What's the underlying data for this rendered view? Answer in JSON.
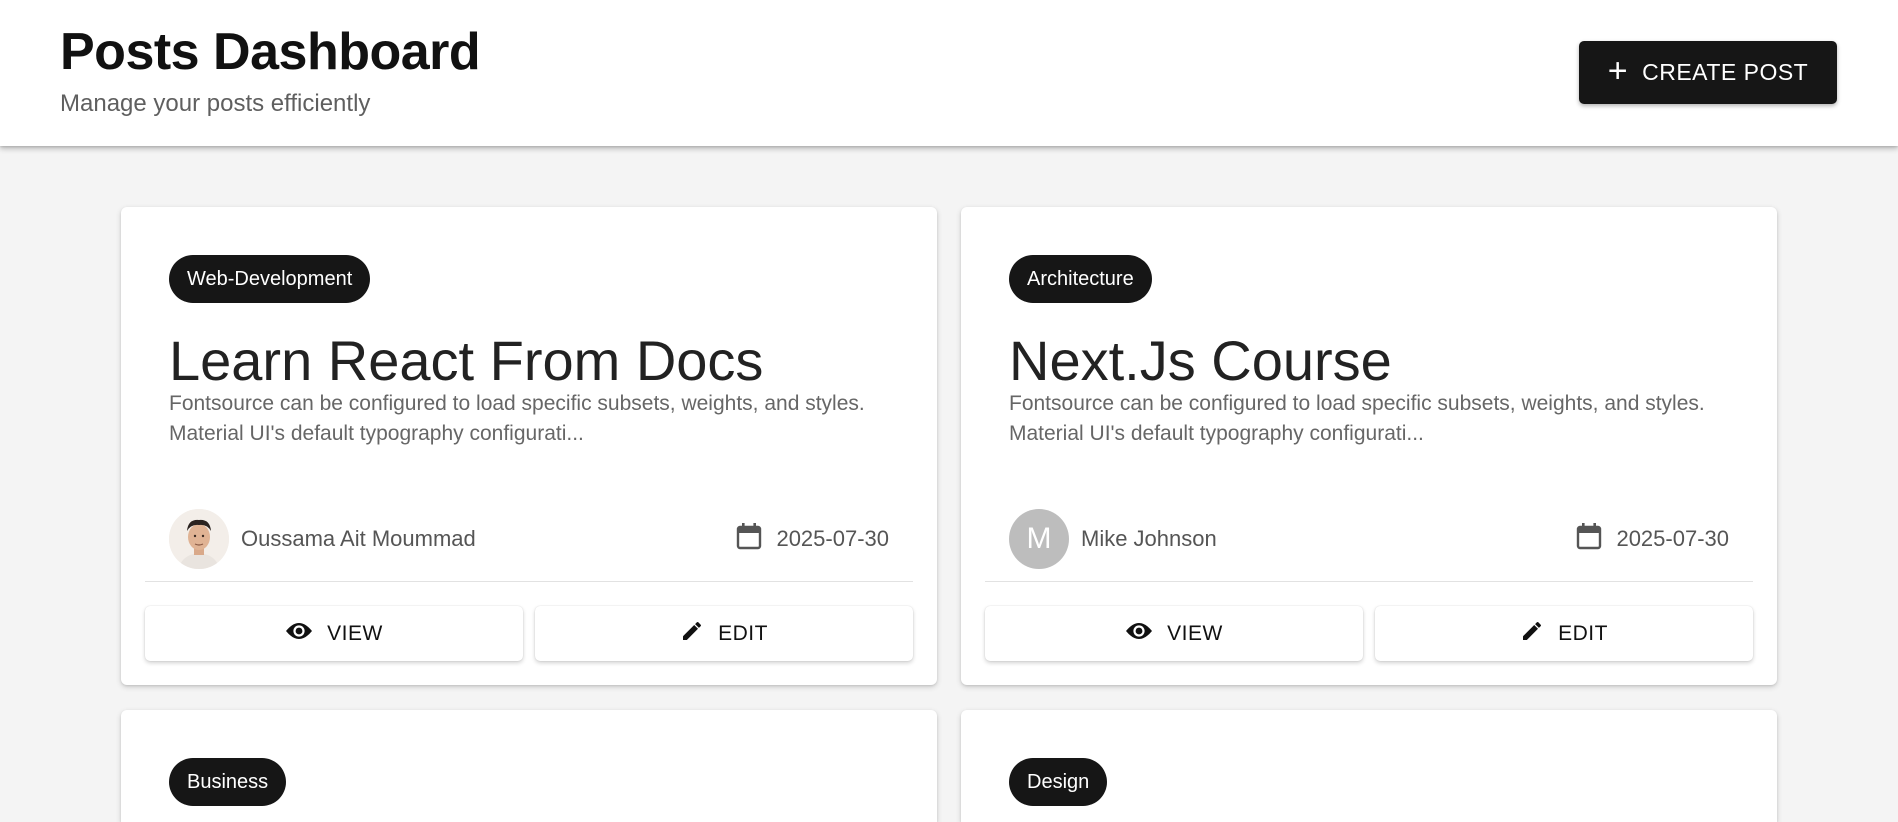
{
  "header": {
    "title": "Posts Dashboard",
    "subtitle": "Manage your posts efficiently",
    "create_label": "CREATE POST",
    "create_icon": "plus-icon"
  },
  "posts": [
    {
      "category": "Web-Development",
      "title": "Learn React From Docs",
      "excerpt": "Fontsource can be configured to load specific subsets, weights, and styles. Material UI's default typography configurati...",
      "author": "Oussama Ait Moummad",
      "avatar": "photo",
      "date": "2025-07-30",
      "view_label": "VIEW",
      "edit_label": "EDIT"
    },
    {
      "category": "Architecture",
      "title": "Next.Js Course",
      "excerpt": "Fontsource can be configured to load specific subsets, weights, and styles. Material UI's default typography configurati...",
      "author": "Mike Johnson",
      "avatar_letter": "M",
      "date": "2025-07-30",
      "view_label": "VIEW",
      "edit_label": "EDIT"
    },
    {
      "category": "Business"
    },
    {
      "category": "Design"
    }
  ],
  "colors": {
    "primary": "#161616",
    "background": "#f4f4f4",
    "text_secondary": "#666666",
    "avatar_gray": "#bdbdbd"
  }
}
